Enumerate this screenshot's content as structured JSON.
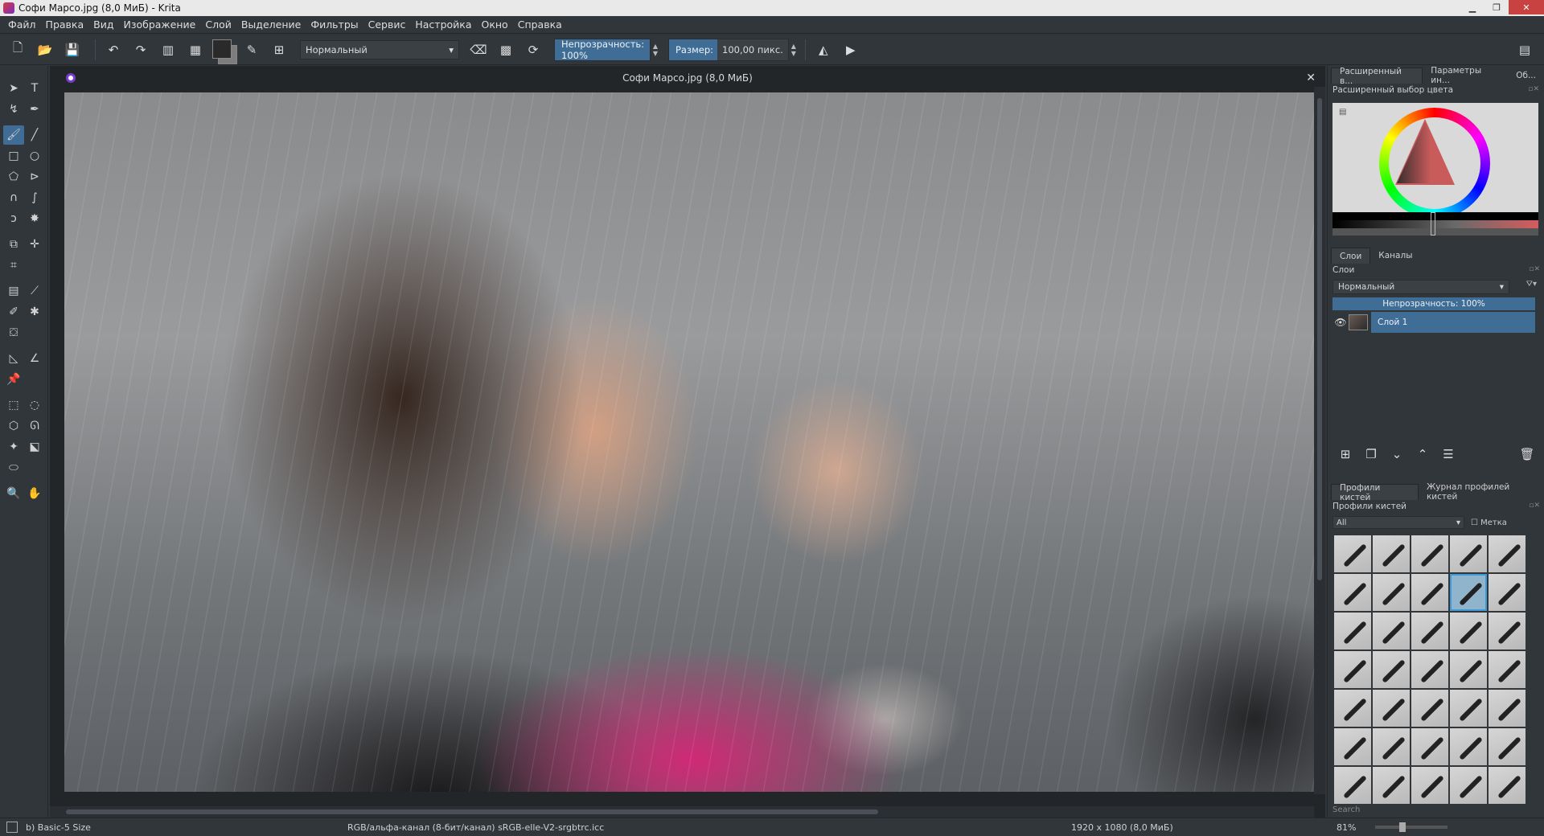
{
  "window": {
    "title": "Софи Марсо.jpg (8,0 МиБ) - Krita"
  },
  "menu": [
    "Файл",
    "Правка",
    "Вид",
    "Изображение",
    "Слой",
    "Выделение",
    "Фильтры",
    "Сервис",
    "Настройка",
    "Окно",
    "Справка"
  ],
  "toolbar": {
    "blend_mode": "Нормальный",
    "opacity_label": "Непрозрачность: 100%",
    "size_label": "Размер:",
    "size_value": "100,00 пикс."
  },
  "document": {
    "tab_title": "Софи Марсо.jpg (8,0 МиБ)"
  },
  "dock": {
    "top_tabs": [
      "Расширенный в...",
      "Параметры ин...",
      "Об..."
    ],
    "color_panel_title": "Расширенный выбор цвета",
    "layer_tabs": [
      "Слои",
      "Каналы"
    ],
    "layers_title": "Слои",
    "layer_blend": "Нормальный",
    "layer_opacity": "Непрозрачность: 100%",
    "layer_name": "Слой 1",
    "brush_tabs": [
      "Профили кистей",
      "Журнал профилей кистей"
    ],
    "brush_title": "Профили кистей",
    "brush_filter": "All",
    "brush_tag": "Метка",
    "brush_search": "Search"
  },
  "status": {
    "brush": "b) Basic-5 Size",
    "colorspace": "RGB/альфа-канал (8-бит/канал)  sRGB-elle-V2-srgbtrc.icc",
    "dimensions": "1920 x 1080 (8,0 МиБ)",
    "zoom": "81%"
  },
  "colors": {
    "accent": "#3f6d96",
    "panel_bg": "#31363b",
    "canvas_bg": "#232629"
  }
}
